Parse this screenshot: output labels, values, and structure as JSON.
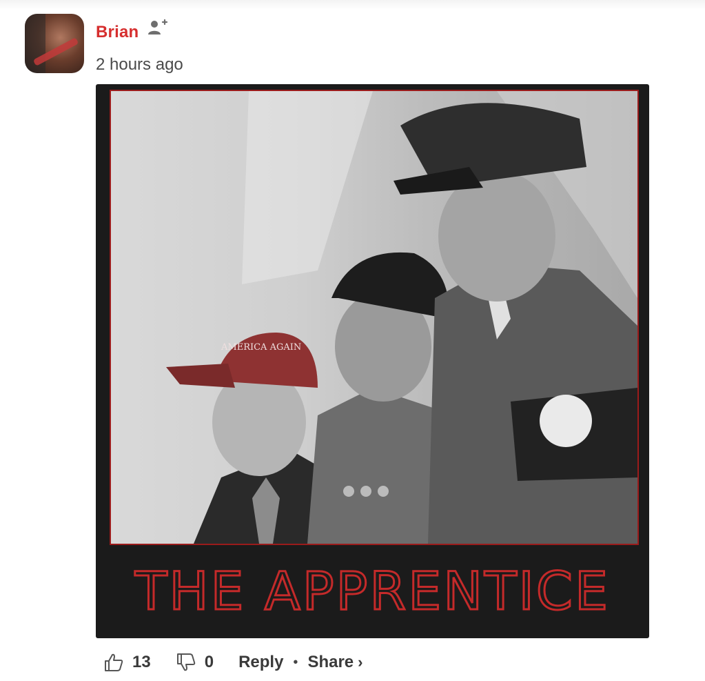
{
  "comment": {
    "author": "Brian",
    "timestamp": "2 hours ago",
    "image_caption": "THE APPRENTICE",
    "cap_text": "AMERICA AGAIN",
    "likes": "13",
    "dislikes": "0",
    "reply_label": "Reply",
    "share_label": "Share",
    "separator": "•",
    "chevron": "›"
  },
  "colors": {
    "author_name": "#d62e2e",
    "poster_background": "#1b1b1b",
    "caption_stroke": "#c42a2a"
  },
  "icons": [
    "follow-user-icon",
    "thumbs-up-icon",
    "thumbs-down-icon",
    "chevron-right-icon"
  ]
}
